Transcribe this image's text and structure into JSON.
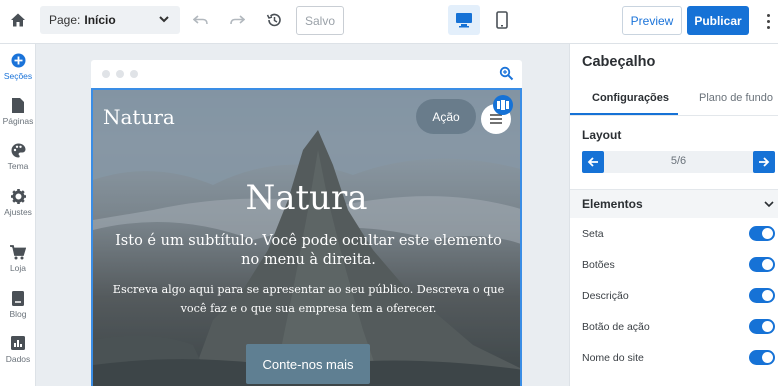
{
  "topbar": {
    "page_label": "Page:",
    "page_value": "Início",
    "saved_label": "Salvo",
    "preview_label": "Preview",
    "publish_label": "Publicar"
  },
  "rail": {
    "items": [
      {
        "label": "Seções",
        "icon": "plus-circle-icon"
      },
      {
        "label": "Páginas",
        "icon": "page-icon"
      },
      {
        "label": "Tema",
        "icon": "palette-icon"
      },
      {
        "label": "Ajustes",
        "icon": "gear-icon"
      },
      {
        "label": "Loja",
        "icon": "cart-icon"
      },
      {
        "label": "Blog",
        "icon": "bookmark-icon"
      },
      {
        "label": "Dados",
        "icon": "chart-icon"
      }
    ]
  },
  "site": {
    "name": "Natura",
    "action_label": "Ação",
    "title": "Natura",
    "subtitle": "Isto é um subtítulo. Você pode ocultar este elemento no menu à direita.",
    "description": "Escreva algo aqui para se apresentar ao seu público. Descreva o que você faz e o que sua empresa tem a oferecer.",
    "cta_label": "Conte-nos mais"
  },
  "panel": {
    "title": "Cabeçalho",
    "tabs": [
      "Configurações",
      "Plano de fundo"
    ],
    "layout_label": "Layout",
    "layout_value": "5/6",
    "elements_label": "Elementos",
    "elements": [
      {
        "label": "Seta",
        "on": true
      },
      {
        "label": "Botões",
        "on": true
      },
      {
        "label": "Descrição",
        "on": true
      },
      {
        "label": "Botão de ação",
        "on": true
      },
      {
        "label": "Nome do site",
        "on": true
      }
    ]
  },
  "colors": {
    "accent": "#1672d6",
    "rail_active": "#1a73d9"
  }
}
